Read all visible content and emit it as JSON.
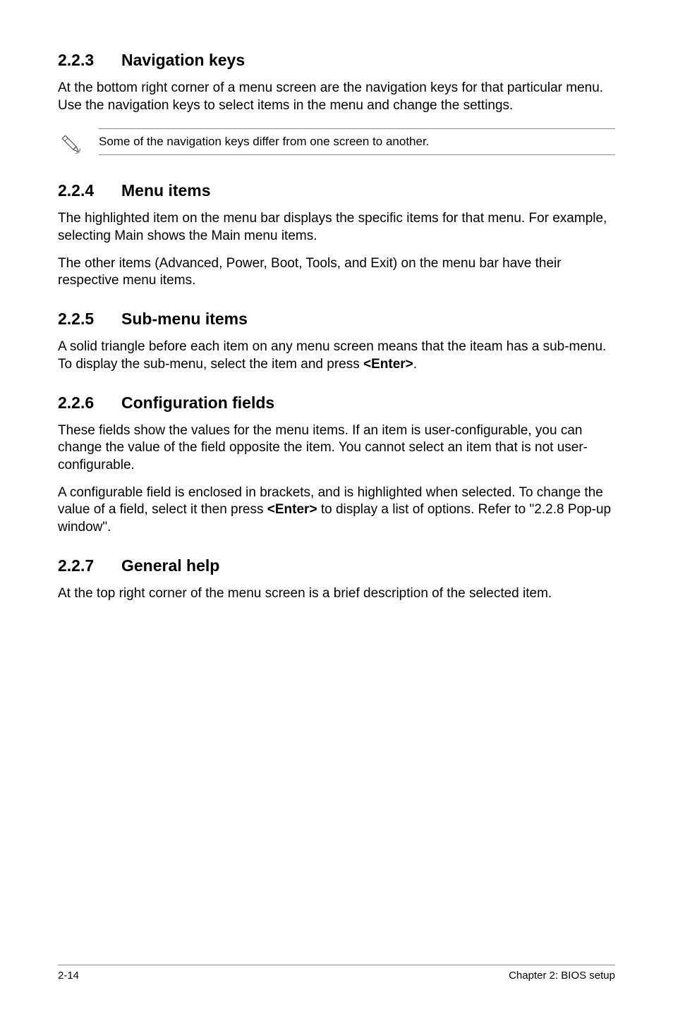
{
  "sections": [
    {
      "number": "2.2.3",
      "title": "Navigation keys",
      "paragraphs": [
        "At the bottom right corner of a menu screen are the navigation keys for that particular menu. Use the navigation keys to select items in the menu and change the settings."
      ],
      "note": "Some of the navigation keys differ from one screen to another."
    },
    {
      "number": "2.2.4",
      "title": "Menu items",
      "paragraphs": [
        "The highlighted item on the menu bar  displays the specific items for that menu. For example, selecting Main shows the Main menu items.",
        "The other items (Advanced, Power, Boot, Tools, and Exit) on the menu bar have their respective menu items."
      ]
    },
    {
      "number": "2.2.5",
      "title": "Sub-menu items",
      "p_prefix": "A solid triangle before each item on any menu screen means that the iteam has a sub-menu. To display the sub-menu, select the item and press ",
      "p_bold": "<Enter>",
      "p_suffix": "."
    },
    {
      "number": "2.2.6",
      "title": "Configuration fields",
      "paragraphs": [
        "These fields show the values for the menu items. If an item is user-configurable, you can change the value of the field opposite the item. You cannot select an item that is not user-configurable."
      ],
      "p_prefix": "A configurable field is enclosed in brackets, and is highlighted when selected. To change the value of a field, select it then press ",
      "p_bold": "<Enter>",
      "p_suffix": " to display a list of options. Refer to \"2.2.8 Pop-up window\"."
    },
    {
      "number": "2.2.7",
      "title": "General help",
      "paragraphs": [
        "At the top right corner of the menu screen is a brief description of the selected item."
      ]
    }
  ],
  "footer": {
    "page": "2-14",
    "chapter": "Chapter 2: BIOS setup"
  }
}
